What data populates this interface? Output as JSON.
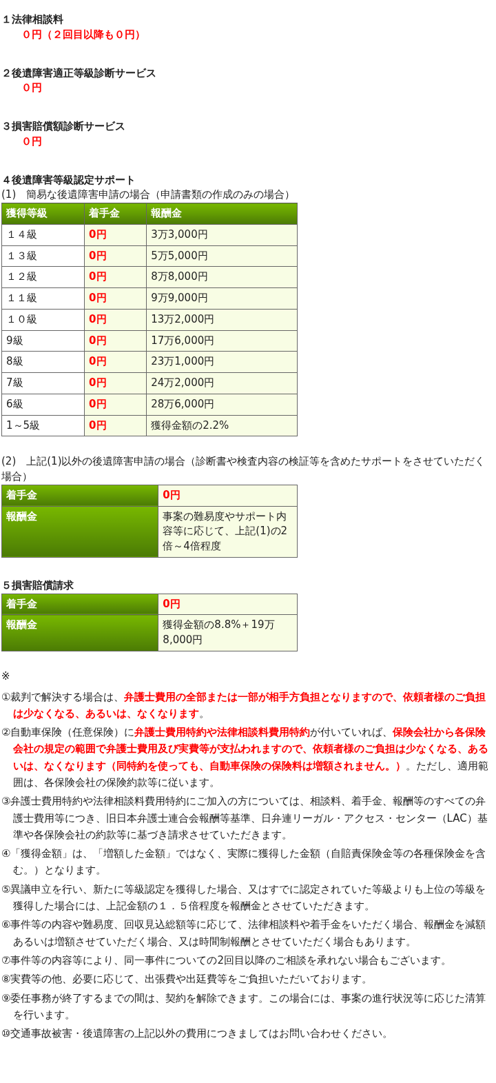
{
  "sections": [
    {
      "title": "１法律相談料",
      "value": "０円（２回目以降も０円）"
    },
    {
      "title": "２後遺障害適正等級診断サービス",
      "value": "０円"
    },
    {
      "title": "３損害賠償額診断サービス",
      "value": "０円"
    }
  ],
  "support": {
    "title": "４後遺障害等級認定サポート",
    "simple": {
      "caption": "(1)　簡易な後遺障害申請の場合（申請書類の作成のみの場合）",
      "columns": [
        "獲得等級",
        "着手金",
        "報酬金"
      ],
      "rows": [
        {
          "grade": "１４級",
          "fee": "0円",
          "reward": "3万3,000円"
        },
        {
          "grade": "１３級",
          "fee": "0円",
          "reward": "5万5,000円"
        },
        {
          "grade": "１２級",
          "fee": "0円",
          "reward": "8万8,000円"
        },
        {
          "grade": "１１級",
          "fee": "0円",
          "reward": "9万9,000円"
        },
        {
          "grade": "１０級",
          "fee": "0円",
          "reward": "13万2,000円"
        },
        {
          "grade": "9級",
          "fee": "0円",
          "reward": "17万6,000円"
        },
        {
          "grade": "8級",
          "fee": "0円",
          "reward": "23万1,000円"
        },
        {
          "grade": "7級",
          "fee": "0円",
          "reward": "24万2,000円"
        },
        {
          "grade": "6級",
          "fee": "0円",
          "reward": "28万6,000円"
        },
        {
          "grade": "1～5級",
          "fee": "0円",
          "reward": "獲得金額の2.2%"
        }
      ]
    },
    "full": {
      "caption": "(2)　上記(1)以外の後遺障害申請の場合（診断書や検査内容の検証等を含めたサポートをさせていただく場合）",
      "rows": [
        {
          "label": "着手金",
          "value": "0円",
          "emphasis": true
        },
        {
          "label": "報酬金",
          "value": "事案の難易度やサポート内容等に応じて、上記(1)の2倍～4倍程度",
          "emphasis": false
        }
      ]
    }
  },
  "claim": {
    "title": "５損害賠償請求",
    "rows": [
      {
        "label": "着手金",
        "value": "0円",
        "emphasis": true
      },
      {
        "label": "報酬金",
        "value": "獲得金額の8.8%＋19万8,000円",
        "emphasis": false
      }
    ]
  },
  "notes": {
    "mark": "※",
    "items": [
      "①裁判で解決する場合は、**弁護士費用の全部または一部が相手方負担となりますので、依頼者様のご負担は少なくなる、あるいは、なくなります**。",
      "②自動車保険（任意保険）に**弁護士費用特約や法律相談料費用特約**が付いていれば、**保険会社から各保険会社の規定の範囲で弁護士費用及び実費等が支払われますので、依頼者様のご負担は少なくなる、あるいは、なくなります（同特約を使っても、自動車保険の保険料は増額されません。）**。ただし、適用範囲は、各保険会社の保険約款等に従います。",
      "③弁護士費用特約や法律相談料費用特約にご加入の方については、相談料、着手金、報酬等のすべての弁護士費用等につき、旧日本弁護士連合会報酬等基準、日弁連リーガル・アクセス・センター（LAC）基準や各保険会社の約款等に基づき請求させていただきます。",
      "④「獲得金額」は、「増額した金額」ではなく、実際に獲得した金額（自賠責保険金等の各種保険金を含む。）となります。",
      "⑤異議申立を行い、新たに等級認定を獲得した場合、又はすでに認定されていた等級よりも上位の等級を獲得した場合には、上記金額の１．５倍程度を報酬金とさせていただきます。",
      "⑥事件等の内容や難易度、回収見込総額等に応じて、法律相談料や着手金をいただく場合、報酬金を減額あるいは増額させていただく場合、又は時間制報酬とさせていただく場合もあります。",
      "⑦事件等の内容等により、同一事件についての2回目以降のご相談を承れない場合もございます。",
      "⑧実費等の他、必要に応じて、出張費や出廷費等をご負担いただいております。",
      "⑨委任事務が終了するまでの間は、契約を解除できます。この場合には、事案の進行状況等に応じた清算を行います。",
      "⑩交通事故被害・後遺障害の上記以外の費用につきましてはお問い合わせください。"
    ]
  }
}
